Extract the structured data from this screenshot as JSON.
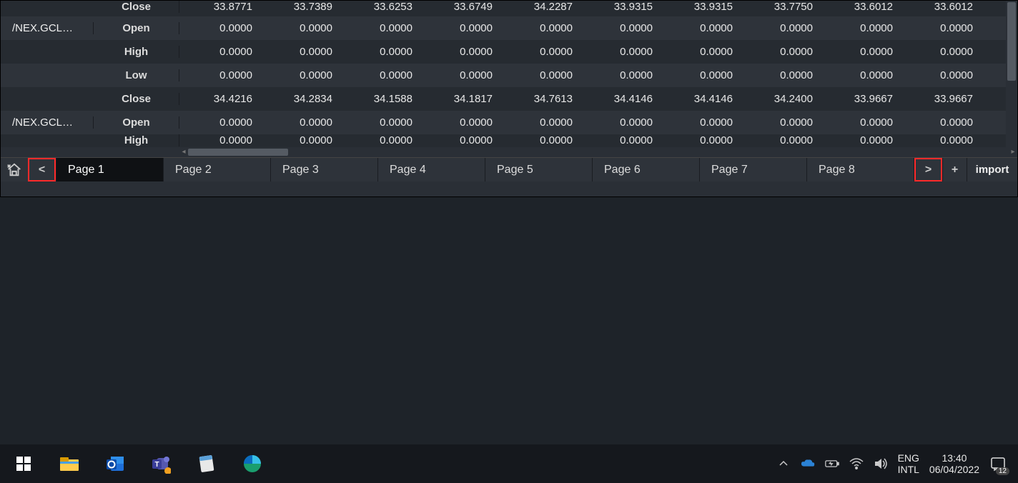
{
  "table": {
    "rows": [
      {
        "symbol": "",
        "label": "Close",
        "vals": [
          "33.8771",
          "33.7389",
          "33.6253",
          "33.6749",
          "34.2287",
          "33.9315",
          "33.9315",
          "33.7750",
          "33.6012",
          "33.6012"
        ]
      },
      {
        "symbol": "/NEX.GCL…",
        "label": "Open",
        "vals": [
          "0.0000",
          "0.0000",
          "0.0000",
          "0.0000",
          "0.0000",
          "0.0000",
          "0.0000",
          "0.0000",
          "0.0000",
          "0.0000"
        ]
      },
      {
        "symbol": "",
        "label": "High",
        "vals": [
          "0.0000",
          "0.0000",
          "0.0000",
          "0.0000",
          "0.0000",
          "0.0000",
          "0.0000",
          "0.0000",
          "0.0000",
          "0.0000"
        ]
      },
      {
        "symbol": "",
        "label": "Low",
        "vals": [
          "0.0000",
          "0.0000",
          "0.0000",
          "0.0000",
          "0.0000",
          "0.0000",
          "0.0000",
          "0.0000",
          "0.0000",
          "0.0000"
        ]
      },
      {
        "symbol": "",
        "label": "Close",
        "vals": [
          "34.4216",
          "34.2834",
          "34.1588",
          "34.1817",
          "34.7613",
          "34.4146",
          "34.4146",
          "34.2400",
          "33.9667",
          "33.9667"
        ]
      },
      {
        "symbol": "/NEX.GCL…",
        "label": "Open",
        "vals": [
          "0.0000",
          "0.0000",
          "0.0000",
          "0.0000",
          "0.0000",
          "0.0000",
          "0.0000",
          "0.0000",
          "0.0000",
          "0.0000"
        ]
      },
      {
        "symbol": "",
        "label": "High",
        "vals": [
          "0.0000",
          "0.0000",
          "0.0000",
          "0.0000",
          "0.0000",
          "0.0000",
          "0.0000",
          "0.0000",
          "0.0000",
          "0.0000"
        ]
      }
    ]
  },
  "tabs": {
    "prev": "<",
    "next": ">",
    "plus": "+",
    "import": "import",
    "items": [
      {
        "label": "Page 1",
        "active": true
      },
      {
        "label": "Page 2"
      },
      {
        "label": "Page 3"
      },
      {
        "label": "Page 4"
      },
      {
        "label": "Page 5"
      },
      {
        "label": "Page 6"
      },
      {
        "label": "Page 7"
      },
      {
        "label": "Page 8"
      }
    ]
  },
  "taskbar": {
    "lang1": "ENG",
    "lang2": "INTL",
    "time": "13:40",
    "date": "06/04/2022",
    "badge": "12"
  }
}
